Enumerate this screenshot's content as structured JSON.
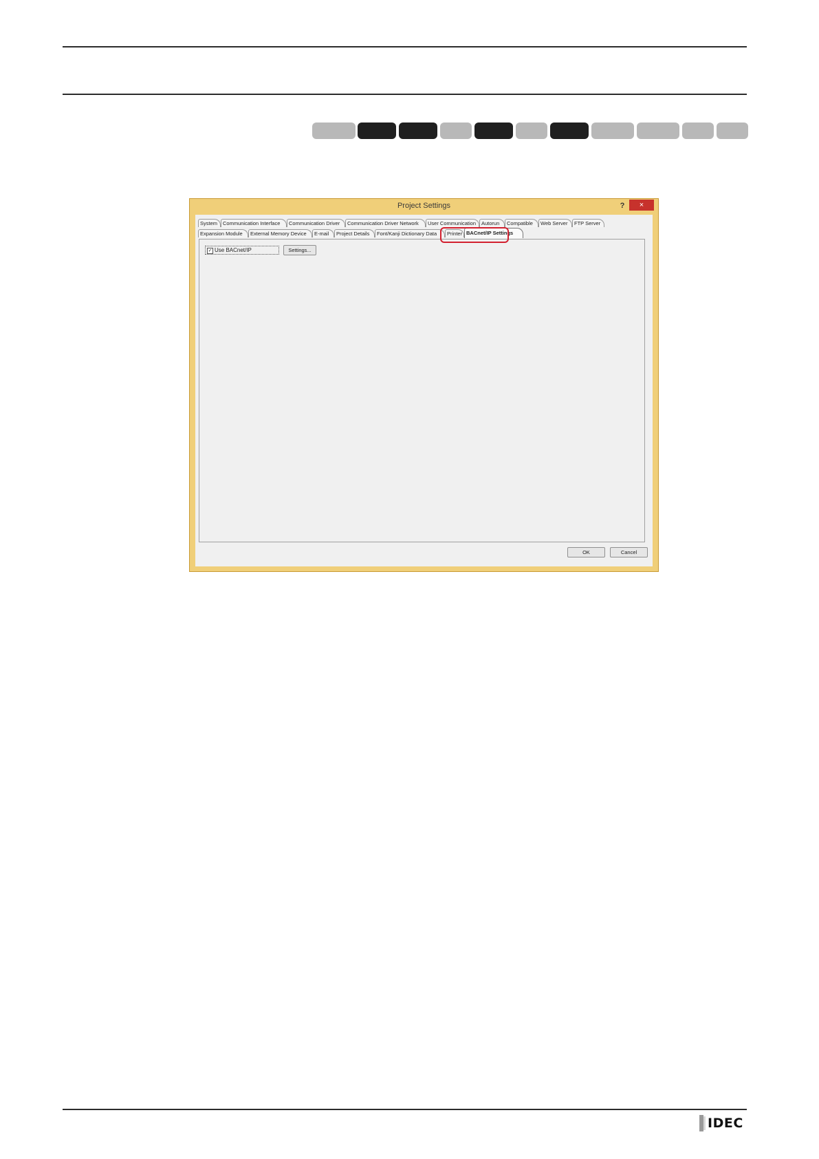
{
  "badges": [
    {
      "active": false
    },
    {
      "active": true
    },
    {
      "active": true
    },
    {
      "active": false
    },
    {
      "active": true
    },
    {
      "active": false
    },
    {
      "active": true
    },
    {
      "active": false
    },
    {
      "active": false
    },
    {
      "active": false
    },
    {
      "active": false
    }
  ],
  "dialog": {
    "title": "Project Settings",
    "help": "?",
    "close": "×",
    "tabs_row1": [
      "System",
      "Communication Interface",
      "Communication Driver",
      "Communication Driver Network",
      "User Communication",
      "Autorun",
      "Compatible",
      "Web Server",
      "FTP Server"
    ],
    "tabs_row2": [
      "Expansion Module",
      "External Memory Device",
      "E-mail",
      "Project Details",
      "Font/Kanji Dictionary Data",
      "Printer",
      "BACnet/IP Settings"
    ],
    "active_tab": "BACnet/IP Settings",
    "use_bacnet_label": "Use BACnet/IP",
    "use_bacnet_checked": true,
    "settings_button": "Settings...",
    "ok_button": "OK",
    "cancel_button": "Cancel"
  },
  "colors": {
    "window_frame": "#f0cf79",
    "close_button": "#c7322c",
    "highlight": "#d2202f",
    "badge_active": "#1f1f1f",
    "badge_inactive": "#b8b8b8"
  },
  "footer": {
    "logo": "IDEC"
  }
}
